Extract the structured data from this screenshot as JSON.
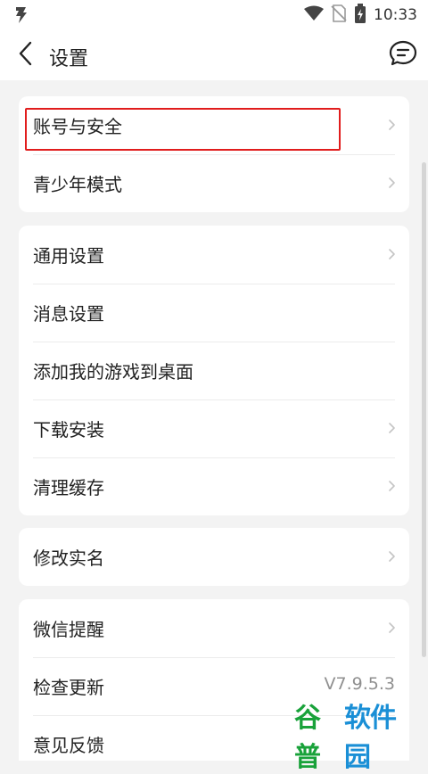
{
  "status_bar": {
    "time": "10:33",
    "icons": [
      "app-logo-icon",
      "wifi-icon",
      "no-sim-icon",
      "battery-charging-icon"
    ]
  },
  "nav": {
    "title": "设置",
    "back_icon": "chevron-left-icon",
    "feedback_icon": "chat-bubble-icon"
  },
  "groups": [
    {
      "items": [
        {
          "label": "账号与安全",
          "chevron": true
        },
        {
          "label": "青少年模式",
          "chevron": true
        }
      ]
    },
    {
      "items": [
        {
          "label": "通用设置",
          "chevron": true
        },
        {
          "label": "消息设置",
          "chevron": false
        },
        {
          "label": "添加我的游戏到桌面",
          "chevron": false
        },
        {
          "label": "下载安装",
          "chevron": true
        },
        {
          "label": "清理缓存",
          "chevron": true
        }
      ]
    },
    {
      "items": [
        {
          "label": "修改实名",
          "chevron": true
        }
      ]
    },
    {
      "items": [
        {
          "label": "微信提醒",
          "chevron": true
        },
        {
          "label": "检查更新",
          "value": "V7.9.5.3"
        },
        {
          "label": "意见反馈",
          "chevron": false
        }
      ]
    }
  ],
  "colors": {
    "background": "#f3f3f3",
    "card": "#ffffff",
    "highlight": "#e11d1d",
    "watermark_green": "#19a23a",
    "watermark_blue": "#1a8fd6"
  },
  "watermark": {
    "part1": "谷普",
    "part2": "软件园"
  }
}
